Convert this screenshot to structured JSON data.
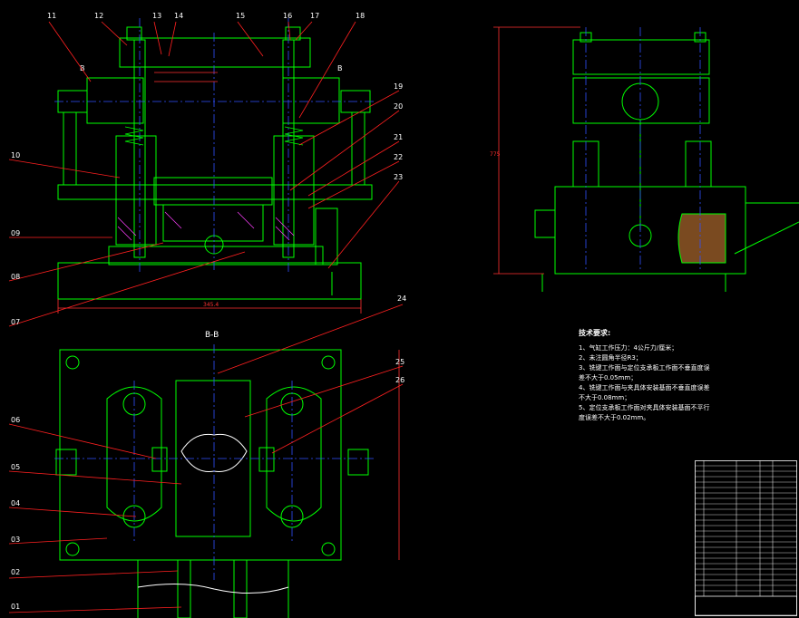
{
  "balloons_left": [
    "11",
    "12",
    "13",
    "14",
    "15",
    "16",
    "17",
    "18",
    "19",
    "20",
    "21",
    "22",
    "23",
    "24",
    "25",
    "26",
    "10",
    "09",
    "08",
    "07",
    "06",
    "05",
    "04",
    "03",
    "02",
    "01"
  ],
  "section_label": "B-B",
  "section_marks": [
    "B",
    "B"
  ],
  "dimension_values": [
    "345.4",
    "775"
  ],
  "notes": {
    "heading": "技术要求:",
    "lines": [
      "1、气缸工作压力：4公斤力/厘米；",
      "2、未注圆角半径R3；",
      "3、铣键工作面与定位支承板工作面不垂直度误",
      "差不大于0.05mm；",
      "4、铣键工作面与夹具体安装基面不垂直度误差",
      "不大于0.08mm；",
      "5、定位支承板工作面对夹具体安装基面不平行",
      "度误差不大于0.02mm。"
    ]
  },
  "colors": {
    "background": "#000000",
    "outline": "#00ff00",
    "centerline": "#3050ff",
    "leader": "#ff2020",
    "dimension": "#ff3030",
    "hatch": "#ff40ff",
    "text": "#ffffff",
    "dark_part": "#7a4a20"
  }
}
